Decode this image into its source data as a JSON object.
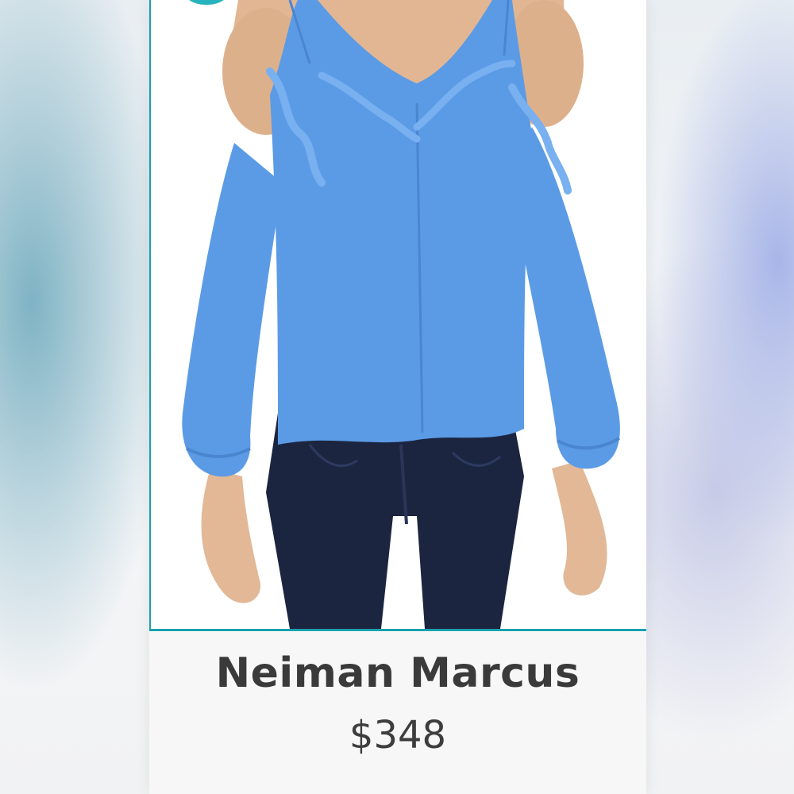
{
  "product": {
    "brand": "Neiman Marcus",
    "price": "$348",
    "image_description": "blue-cold-shoulder-ruffle-blouse",
    "colors": {
      "blouse": "#5b9be6",
      "jeans": "#1c2540",
      "accent": "#1aa0ad"
    }
  }
}
